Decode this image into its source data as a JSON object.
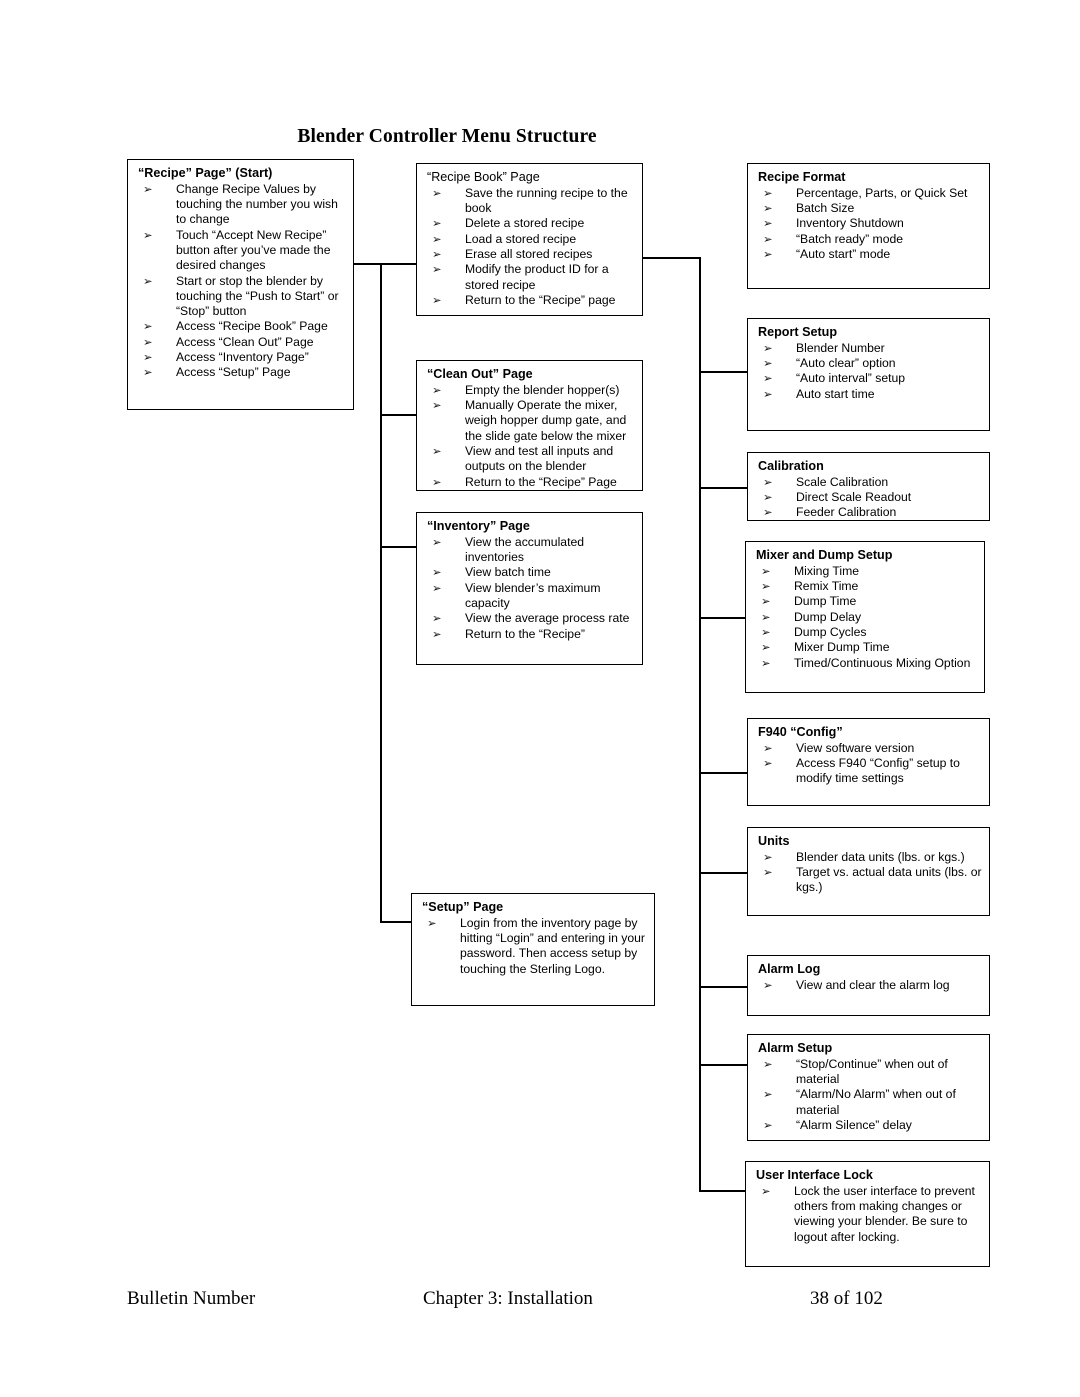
{
  "title": "Blender Controller Menu Structure",
  "footer": {
    "left": "Bulletin Number",
    "center": "Chapter 3: Installation",
    "right": "38 of 102"
  },
  "nodes": {
    "recipe_page": {
      "title": "“Recipe” Page” (Start)",
      "items": [
        "Change Recipe Values by touching the number you wish to change",
        "Touch “Accept New Recipe” button after you’ve made the desired changes",
        "Start or stop the blender by touching the “Push to Start” or “Stop” button",
        "Access “Recipe Book” Page",
        "Access “Clean Out” Page",
        "Access “Inventory Page”",
        "Access “Setup” Page"
      ]
    },
    "recipe_book": {
      "title": "“Recipe Book” Page",
      "items": [
        "Save the running recipe to the book",
        "Delete a stored recipe",
        "Load a stored recipe",
        "Erase all stored recipes",
        "Modify the product ID for a stored recipe",
        "Return to the “Recipe” page"
      ]
    },
    "clean_out": {
      "title": "“Clean Out” Page",
      "items": [
        "Empty the blender hopper(s)",
        "Manually Operate the mixer, weigh hopper dump gate, and the slide gate below the mixer",
        "View and test all inputs and outputs on the blender",
        "Return to the “Recipe” Page"
      ]
    },
    "inventory": {
      "title": "“Inventory” Page",
      "items": [
        "View the accumulated inventories",
        "View batch time",
        "View blender’s maximum capacity",
        "View the average process rate",
        "Return to the “Recipe”"
      ]
    },
    "setup": {
      "title": "“Setup” Page",
      "items": [
        "Login from the inventory page by hitting “Login” and entering in your password. Then access setup by touching the Sterling Logo."
      ]
    },
    "recipe_format": {
      "title": "Recipe Format",
      "items": [
        "Percentage, Parts, or Quick Set",
        "Batch Size",
        "Inventory Shutdown",
        "“Batch ready” mode",
        "“Auto start” mode"
      ]
    },
    "report_setup": {
      "title": "Report Setup",
      "items": [
        "Blender Number",
        "“Auto clear” option",
        "“Auto interval” setup",
        "Auto start time"
      ]
    },
    "calibration": {
      "title": "Calibration",
      "items": [
        "Scale Calibration",
        "Direct Scale Readout",
        "Feeder Calibration"
      ]
    },
    "mixer_dump": {
      "title": "Mixer and Dump Setup",
      "items": [
        "Mixing Time",
        "Remix Time",
        "Dump Time",
        "Dump Delay",
        "Dump Cycles",
        "Mixer Dump Time",
        "Timed/Continuous Mixing Option"
      ]
    },
    "f940_config": {
      "title": "F940 “Config”",
      "items": [
        "View software version",
        "Access F940 “Config” setup to modify time settings"
      ]
    },
    "units": {
      "title": "Units",
      "items": [
        "Blender data units (lbs. or kgs.)",
        "Target vs. actual data units (lbs. or kgs.)"
      ]
    },
    "alarm_log": {
      "title": "Alarm Log",
      "items": [
        "View and clear the alarm log"
      ]
    },
    "alarm_setup": {
      "title": "Alarm Setup",
      "items": [
        "“Stop/Continue” when out of material",
        "“Alarm/No Alarm” when out of material",
        "“Alarm Silence” delay"
      ]
    },
    "ui_lock": {
      "title": "User Interface Lock",
      "items": [
        "Lock the user interface to prevent others from making changes or viewing your blender.  Be sure to logout after locking."
      ]
    }
  }
}
